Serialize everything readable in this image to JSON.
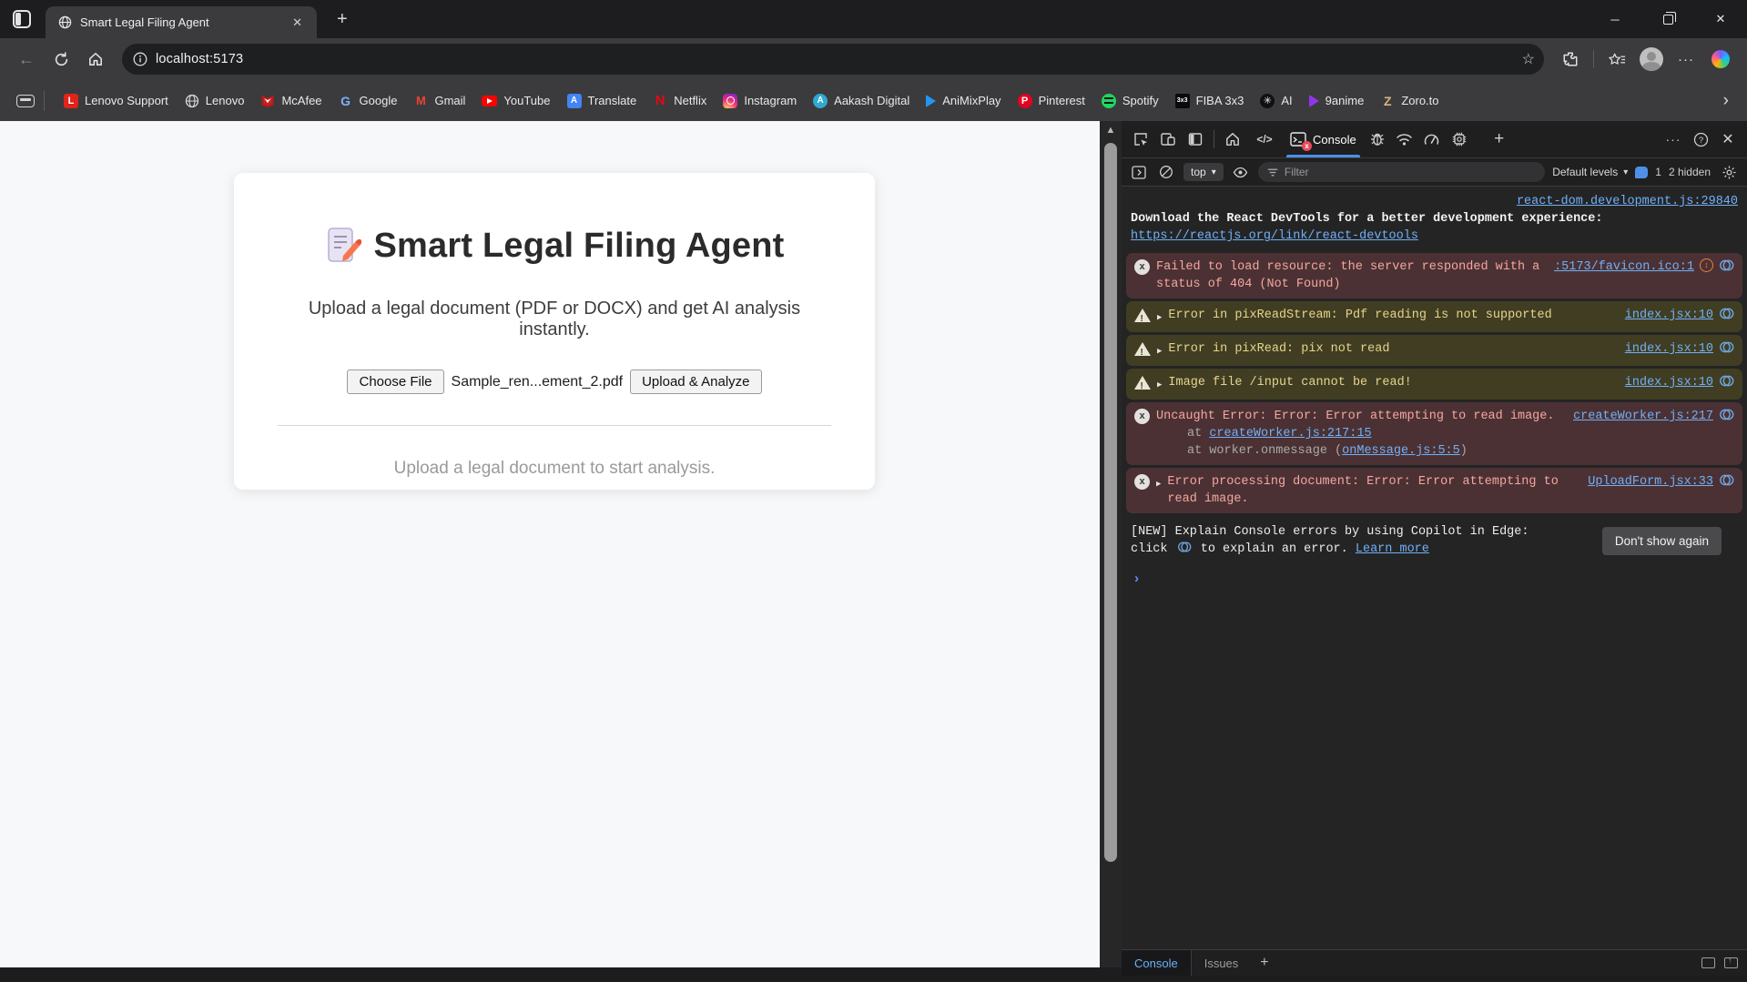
{
  "browser": {
    "tab_title": "Smart Legal Filing Agent",
    "url": "localhost:5173",
    "bookmarks": [
      "Lenovo Support",
      "Lenovo",
      "McAfee",
      "Google",
      "Gmail",
      "YouTube",
      "Translate",
      "Netflix",
      "Instagram",
      "Aakash Digital",
      "AniMixPlay",
      "Pinterest",
      "Spotify",
      "FIBA 3x3",
      "AI",
      "9anime",
      "Zoro.to"
    ]
  },
  "icons": {
    "back": "←",
    "star": "☆",
    "more_dots": "···",
    "plus": "+",
    "close": "✕",
    "minimize": "─",
    "chevron_right": "›",
    "caret_down": "▾",
    "caret_right": "▶",
    "help": "?",
    "code": "</>",
    "prompt": "›",
    "up_arrow": "▲",
    "updown": "↕",
    "fiba_label": "3x3",
    "ai_glyph": "✳",
    "google_g": "G",
    "gmail_m": "M",
    "netflix_n": "N",
    "lenovo_l": "L",
    "pinterest_p": "P",
    "translate_a": "A",
    "aakash_a": "A",
    "zoro_z": "Z"
  },
  "page": {
    "title": "Smart Legal Filing Agent",
    "subtitle": "Upload a legal document (PDF or DOCX) and get AI analysis instantly.",
    "choose_file": "Choose File",
    "file_name": "Sample_ren...ement_2.pdf",
    "upload_button": "Upload & Analyze",
    "footer": "Upload a legal document to start analysis."
  },
  "devtools": {
    "console_tab": "Console",
    "context": "top",
    "filter_placeholder": "Filter",
    "default_levels": "Default levels",
    "issue_count": "1",
    "hidden_label": "2 hidden",
    "messages": [
      {
        "source": "react-dom.development.js:29840",
        "text": "Download the React DevTools for a better development experience:",
        "link": "https://reactjs.org/link/react-devtools"
      },
      {
        "text": "Failed to load resource: the server responded with a status of 404 (Not Found)",
        "source": ":5173/favicon.ico:1"
      },
      {
        "text": "Error in pixReadStream: Pdf reading is not supported",
        "source": "index.jsx:10"
      },
      {
        "text": "Error in pixRead: pix not read",
        "source": "index.jsx:10"
      },
      {
        "text": "Image file /input cannot be read!",
        "source": "index.jsx:10"
      },
      {
        "text": "Uncaught Error: Error: Error attempting to read image.",
        "source": "createWorker.js:217",
        "stack1_prefix": "at ",
        "stack1_link": "createWorker.js:217:15",
        "stack2_prefix": "at worker.onmessage (",
        "stack2_link": "onMessage.js:5:5",
        "stack2_suffix": ")"
      },
      {
        "text": "Error processing document: Error: Error attempting to read image.",
        "source": "UploadForm.jsx:33"
      }
    ],
    "note": {
      "prefix": "[NEW] Explain Console errors by using Copilot in Edge: click",
      "middle": "to explain an error.",
      "link": "Learn more"
    },
    "dont_show_again": "Don't show again",
    "bottom_tabs": {
      "console": "Console",
      "issues": "Issues"
    }
  },
  "colors": {
    "accent_blue": "#4d8fe8",
    "error_bg": "#4b3134",
    "error_text": "#f5a79f",
    "warning_bg": "#403d22",
    "warning_text": "#e5d58b",
    "link_blue": "#71b0f7",
    "issue_orange": "#e8823a"
  }
}
